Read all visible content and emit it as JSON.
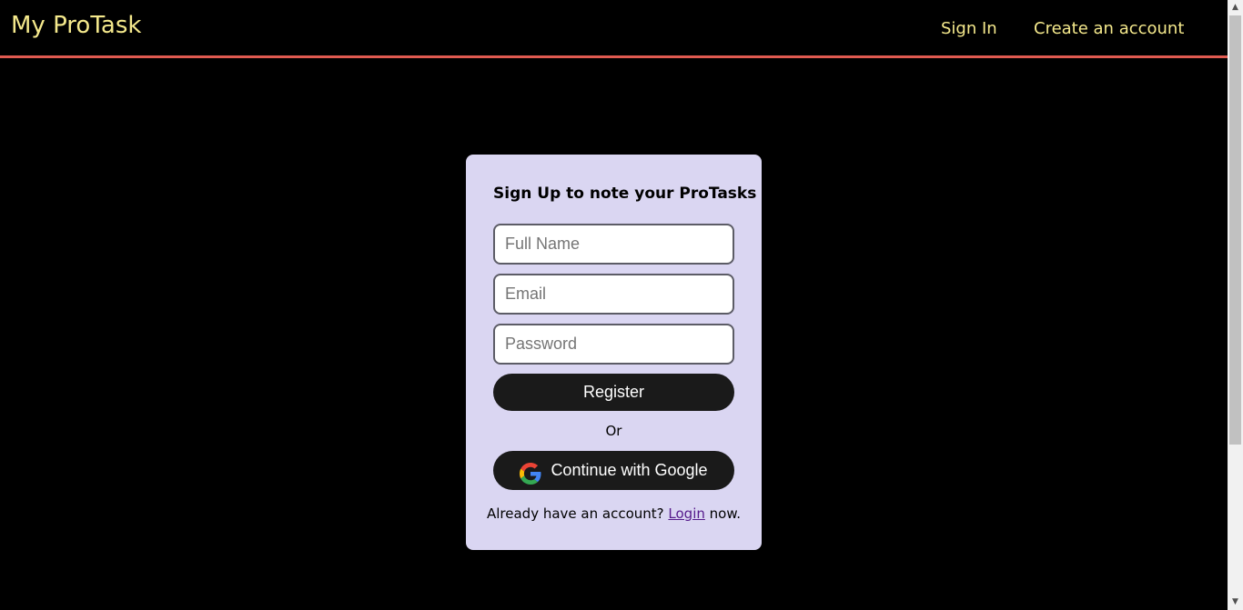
{
  "header": {
    "brand": "My ProTask",
    "nav": {
      "sign_in": "Sign In",
      "create_account": "Create an account"
    }
  },
  "signup_form": {
    "title": "Sign Up to note your ProTasks",
    "fields": {
      "full_name": {
        "placeholder": "Full Name",
        "value": ""
      },
      "email": {
        "placeholder": "Email",
        "value": ""
      },
      "password": {
        "placeholder": "Password",
        "value": ""
      }
    },
    "register_label": "Register",
    "separator": "Or",
    "google_label": "Continue with Google",
    "footer": {
      "prefix": "Already have an account?",
      "link": "Login",
      "suffix": "now."
    }
  },
  "icons": {
    "google": "google-g-icon",
    "scroll_up": "scroll-up-arrow-icon",
    "scroll_down": "scroll-down-arrow-icon"
  },
  "colors": {
    "background": "#000000",
    "nav_text": "#f5e98c",
    "nav_border": "#e05a50",
    "card_background": "#dad6f2",
    "button_background": "#1a1a1a",
    "link": "#551a8b"
  }
}
